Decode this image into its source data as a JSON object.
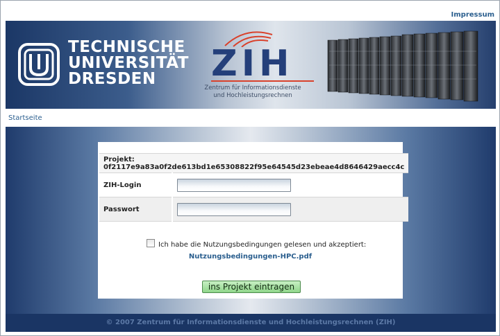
{
  "header": {
    "impressum_link": "Impressum"
  },
  "banner": {
    "tud_lines": [
      "TECHNISCHE",
      "UNIVERSITÄT",
      "DRESDEN"
    ],
    "zih_logo_text": "ZIH",
    "zih_subtitle_lines": [
      "Zentrum für Informationsdienste",
      "und Hochleistungsrechnen"
    ]
  },
  "breadcrumb": {
    "home": "Startseite"
  },
  "form": {
    "project_label": "Projekt: 0f2117e9a83a0f2de613bd1e65308822f95e64545d23ebeae4d8646429aecc4c",
    "login_label": "ZIH-Login",
    "login_value": "",
    "password_label": "Passwort",
    "password_value": "",
    "agree_text": "Ich habe die Nutzungsbedingungen gelesen und akzeptiert:",
    "agree_checked": false,
    "terms_link": "Nutzungsbedingungen-HPC.pdf",
    "submit_label": "ins Projekt eintragen"
  },
  "footer": {
    "copyright": "© 2007 Zentrum für Informationsdienste und Hochleistungsrechnen (ZIH)"
  },
  "colors": {
    "link": "#2a5e8e",
    "banner_dark": "#1b3766",
    "submit_green": "#8fd58a"
  },
  "icons": {
    "university_logo": "tu-dresden-logo-icon",
    "zih_logo": "zih-logo-icon",
    "servers": "server-racks-image"
  }
}
